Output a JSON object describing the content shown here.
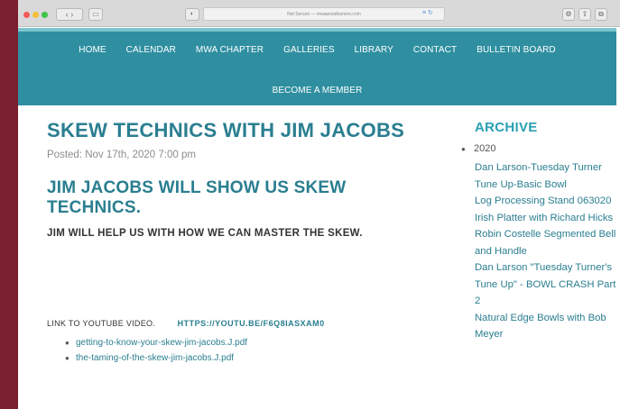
{
  "browser": {
    "url_text": "Not Secure — mwawoodturners.com",
    "nav_back_forward": "‹ ›",
    "sidebar_icon": "sidebar-icon",
    "shield_icon": "shield-icon",
    "reader_icon": "reader-icon"
  },
  "nav": {
    "items": [
      "HOME",
      "CALENDAR",
      "MWA CHAPTER",
      "GALLERIES",
      "LIBRARY",
      "CONTACT",
      "BULLETIN BOARD"
    ],
    "second_row": "BECOME A MEMBER"
  },
  "post": {
    "title": "SKEW TECHNICS WITH JIM JACOBS",
    "meta": "Posted: Nov 17th, 2020 7:00 pm",
    "heading": "JIM JACOBS WILL SHOW US SKEW TECHNICS.",
    "subheading": "JIM WILL HELP US WITH HOW WE CAN MASTER THE SKEW.",
    "youtube_label": "LINK TO YOUTUBE VIDEO.",
    "youtube_link": "HTTPS://YOUTU.BE/F6Q8IASXAM0",
    "files": [
      "getting-to-know-your-skew-jim-jacobs.J.pdf",
      "the-taming-of-the-skew-jim-jacobs.J.pdf"
    ]
  },
  "archive": {
    "title": "ARCHIVE",
    "year": "2020",
    "items": [
      "Dan Larson-Tuesday Turner Tune Up-Basic Bowl",
      "Log Processing Stand 063020",
      "Irish Platter with Richard Hicks",
      "Robin Costelle Segmented Bell and Handle",
      "Dan Larson \"Tuesday Turner's Tune Up\" - BOWL CRASH Part 2",
      "Natural Edge Bowls with Bob Meyer"
    ]
  },
  "colors": {
    "header_bg": "#2f8fa1",
    "accent": "#2a7e90",
    "frame_left": "#7a1f2e"
  }
}
